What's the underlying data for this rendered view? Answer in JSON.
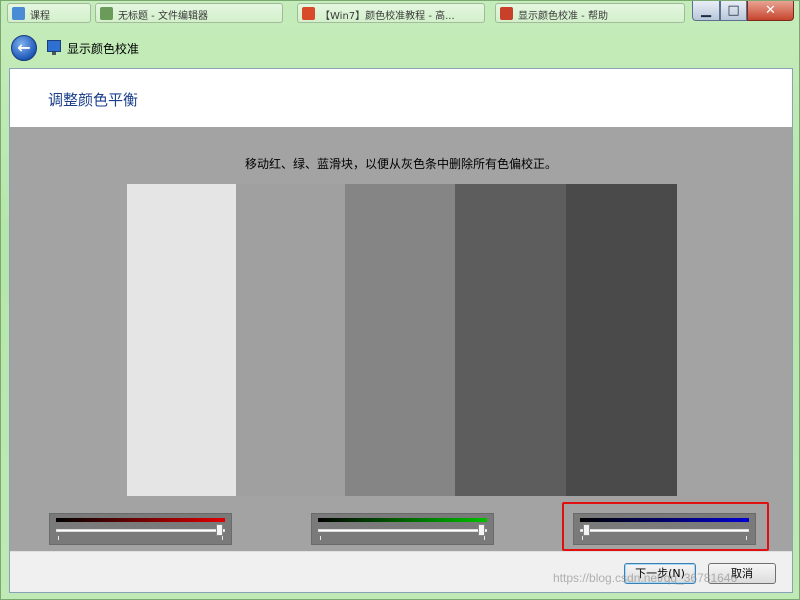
{
  "taskbar": {
    "tasks": [
      {
        "label": "课程",
        "color": "#4a8bd6"
      },
      {
        "label": "无标题 - 文件编辑器",
        "color": "#6a9b5a"
      },
      {
        "label": "【Win7】颜色校准教程 - 高...",
        "color": "#d84a2a"
      },
      {
        "label": "显示颜色校准 - 帮助",
        "color": "#c8402a"
      }
    ]
  },
  "window_controls": {
    "minimize": "▁",
    "maximize": "□",
    "close": "✕"
  },
  "nav": {
    "back_glyph": "←",
    "title": "显示颜色校准"
  },
  "page": {
    "title": "调整颜色平衡",
    "instruction": "移动红、绿、蓝滑块，以便从灰色条中删除所有色偏校正。"
  },
  "gray_bars": [
    "#e5e5e5",
    "#a0a0a0",
    "#858585",
    "#5d5d5d",
    "#4a4a4a"
  ],
  "sliders": [
    {
      "name": "红",
      "color": "#e00000",
      "value_fraction": 0.99
    },
    {
      "name": "绿",
      "color": "#00c000",
      "value_fraction": 0.99
    },
    {
      "name": "蓝",
      "color": "#0000d0",
      "value_fraction": 0.02
    }
  ],
  "buttons": {
    "next": "下一步(N)",
    "cancel": "取消"
  },
  "watermark": "https://blog.csdn.net/qq_36781646"
}
